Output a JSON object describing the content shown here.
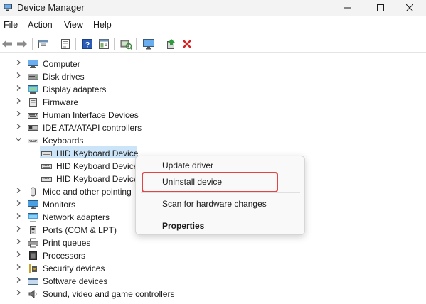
{
  "window": {
    "title": "Device Manager",
    "icon": "device-manager-icon"
  },
  "menubar": {
    "items": [
      "File",
      "Action",
      "View",
      "Help"
    ]
  },
  "toolbar": {
    "buttons": [
      "back-icon",
      "forward-icon",
      "properties-icon",
      "details-icon",
      "help-icon",
      "view-icon",
      "scan-icon",
      "monitor-icon",
      "update-driver-icon",
      "uninstall-icon"
    ]
  },
  "tree": {
    "items": [
      {
        "label": "Computer",
        "icon": "computer-icon",
        "expanded": false
      },
      {
        "label": "Disk drives",
        "icon": "disk-icon",
        "expanded": false
      },
      {
        "label": "Display adapters",
        "icon": "display-adapter-icon",
        "expanded": false
      },
      {
        "label": "Firmware",
        "icon": "firmware-icon",
        "expanded": false
      },
      {
        "label": "Human Interface Devices",
        "icon": "hid-icon",
        "expanded": false
      },
      {
        "label": "IDE ATA/ATAPI controllers",
        "icon": "ide-icon",
        "expanded": false
      },
      {
        "label": "Keyboards",
        "icon": "keyboard-icon",
        "expanded": true
      },
      {
        "label": "HID Keyboard Device",
        "icon": "keyboard-icon",
        "child": true,
        "selected": true
      },
      {
        "label": "HID Keyboard Device",
        "icon": "keyboard-icon",
        "child": true
      },
      {
        "label": "HID Keyboard Device",
        "icon": "keyboard-icon",
        "child": true
      },
      {
        "label": "Mice and other pointing",
        "icon": "mouse-icon",
        "expanded": false
      },
      {
        "label": "Monitors",
        "icon": "monitor-icon",
        "expanded": false
      },
      {
        "label": "Network adapters",
        "icon": "network-icon",
        "expanded": false
      },
      {
        "label": "Ports (COM & LPT)",
        "icon": "port-icon",
        "expanded": false
      },
      {
        "label": "Print queues",
        "icon": "printer-icon",
        "expanded": false
      },
      {
        "label": "Processors",
        "icon": "processor-icon",
        "expanded": false
      },
      {
        "label": "Security devices",
        "icon": "security-icon",
        "expanded": false
      },
      {
        "label": "Software devices",
        "icon": "software-icon",
        "expanded": false
      },
      {
        "label": "Sound, video and game controllers",
        "icon": "sound-icon",
        "expanded": false
      }
    ]
  },
  "context_menu": {
    "items": [
      "Update driver",
      "Uninstall device",
      "Scan for hardware changes",
      "Properties"
    ],
    "highlighted": "Uninstall device",
    "highlight_color": "#e04444"
  },
  "colors": {
    "selection": "#cce4f7",
    "accent_blue": "#2f7fd1",
    "uninstall_red": "#d92020"
  }
}
